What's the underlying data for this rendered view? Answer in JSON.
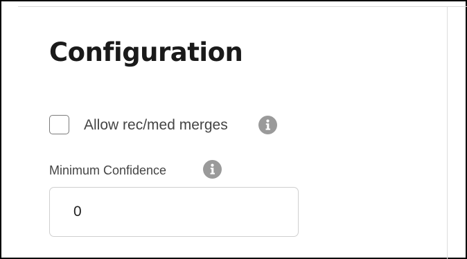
{
  "section": {
    "title": "Configuration"
  },
  "merge_option": {
    "label": "Allow rec/med merges",
    "checked": false,
    "info_icon": "info-icon"
  },
  "min_confidence": {
    "label": "Minimum Confidence",
    "value": "0",
    "info_icon": "info-icon"
  }
}
